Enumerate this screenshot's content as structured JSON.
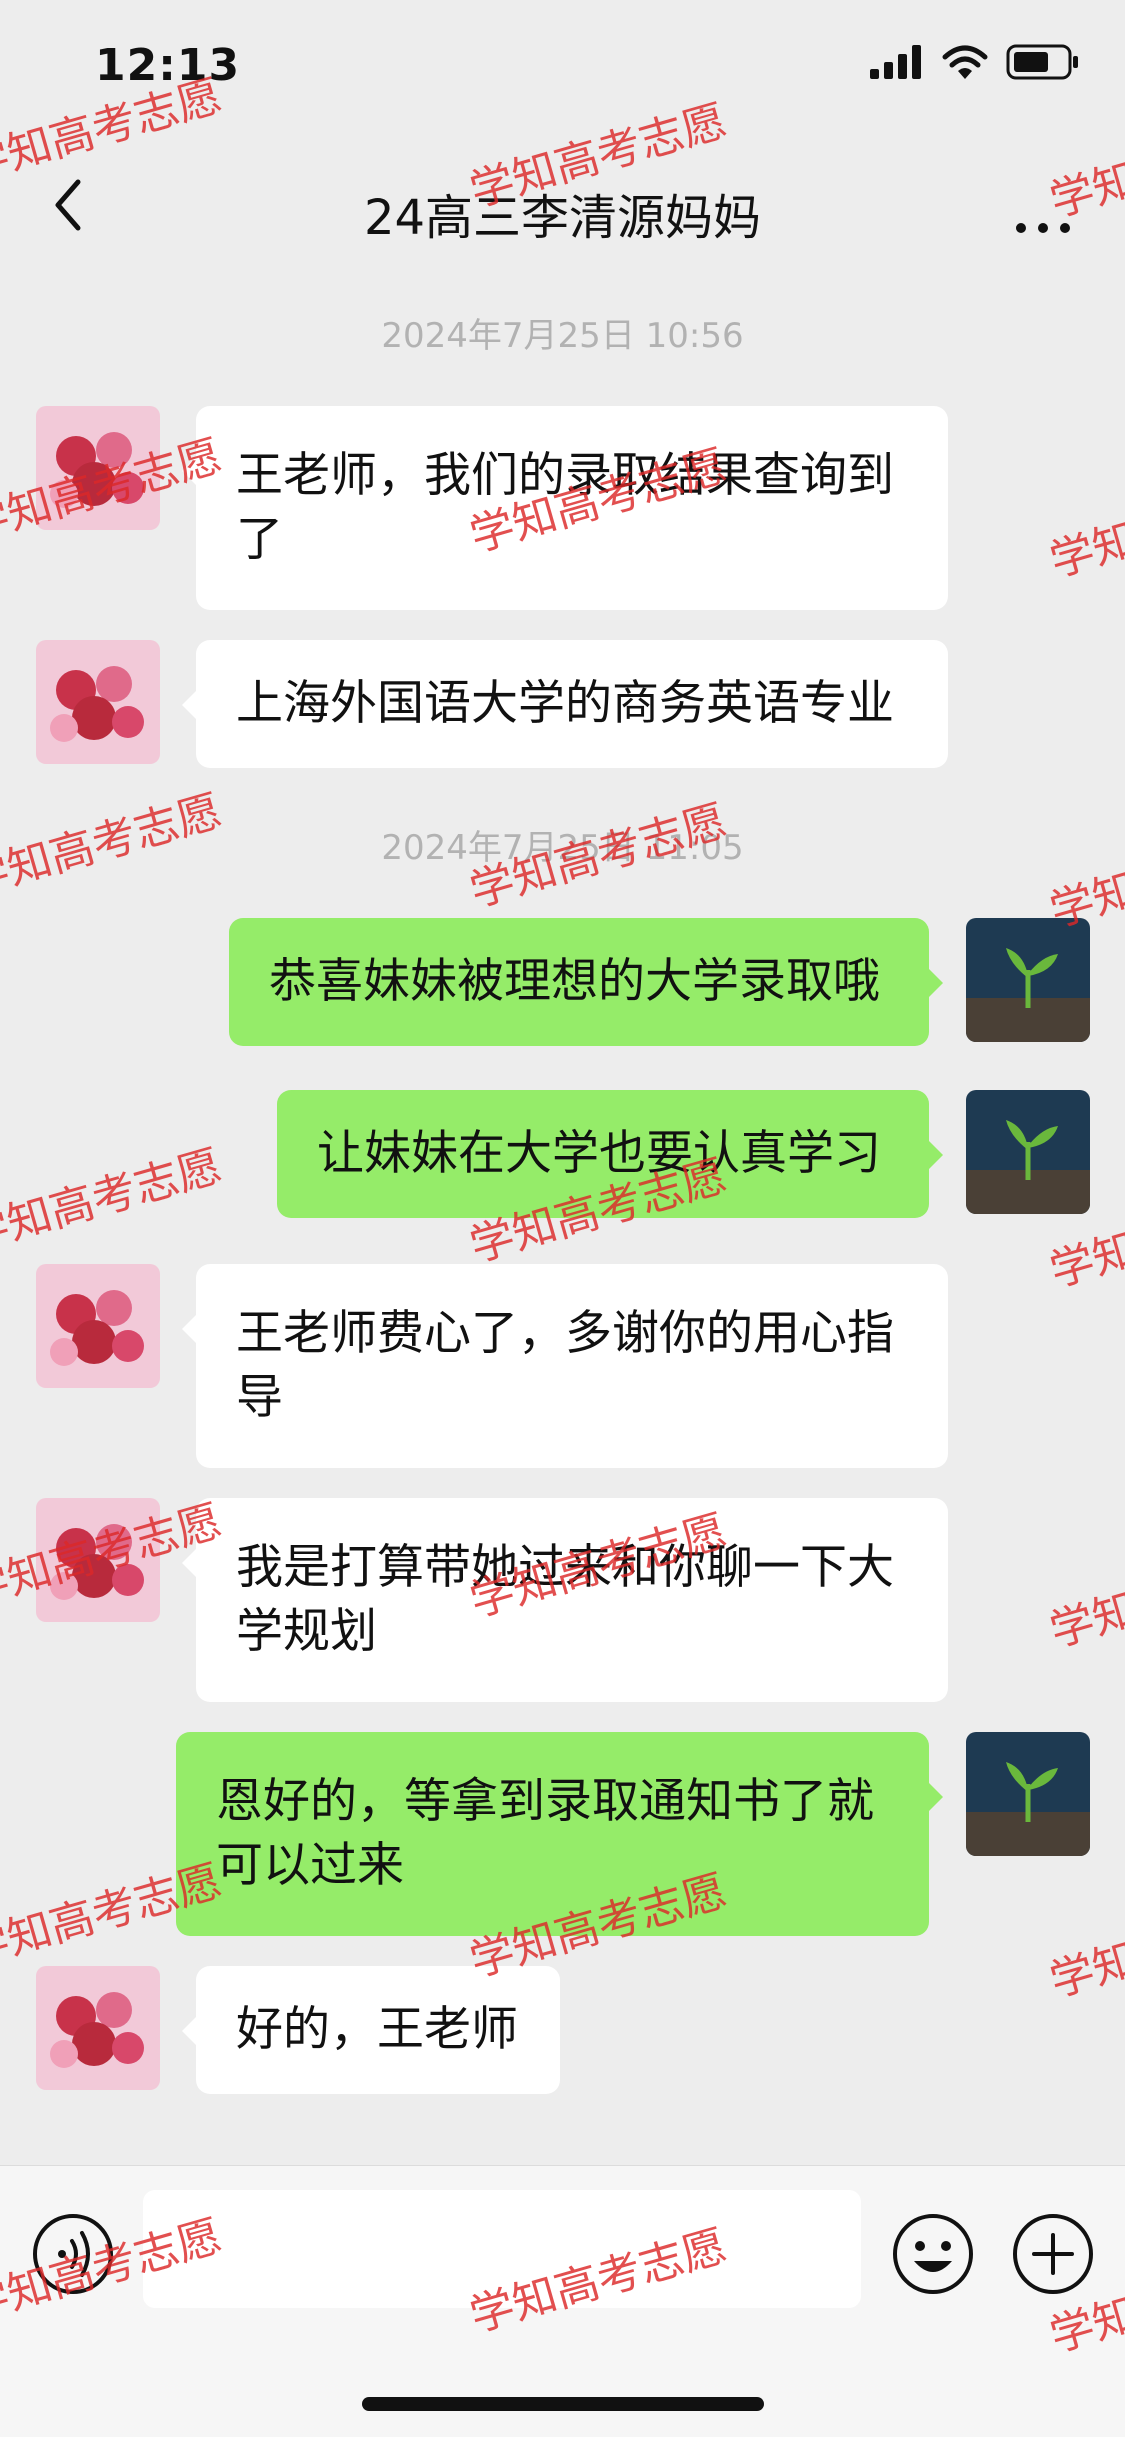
{
  "status_bar": {
    "time": "12:13"
  },
  "header": {
    "title": "24高三李清源妈妈"
  },
  "messages": [
    {
      "type": "timestamp",
      "text": "2024年7月25日 10:56"
    },
    {
      "type": "incoming",
      "text": "王老师，我们的录取结果查询到了"
    },
    {
      "type": "incoming",
      "text": "上海外国语大学的商务英语专业"
    },
    {
      "type": "timestamp",
      "text": "2024年7月25日 11:05"
    },
    {
      "type": "outgoing",
      "text": "恭喜妹妹被理想的大学录取哦"
    },
    {
      "type": "outgoing",
      "text": "让妹妹在大学也要认真学习"
    },
    {
      "type": "incoming",
      "text": "王老师费心了，多谢你的用心指导"
    },
    {
      "type": "incoming",
      "text": "我是打算带她过来和你聊一下大学规划"
    },
    {
      "type": "outgoing",
      "text": "恩好的，等拿到录取通知书了就可以过来"
    },
    {
      "type": "incoming",
      "text": "好的，王老师"
    }
  ],
  "watermark": {
    "text": "学知高考志愿"
  },
  "colors": {
    "background": "#ededed",
    "incoming_bubble": "#ffffff",
    "outgoing_bubble": "#95ec69",
    "watermark": "#dc2828"
  },
  "icons": {
    "back": "chevron-left-icon",
    "more": "more-icon",
    "voice": "voice-icon",
    "emoji": "emoji-icon",
    "plus": "plus-icon"
  }
}
